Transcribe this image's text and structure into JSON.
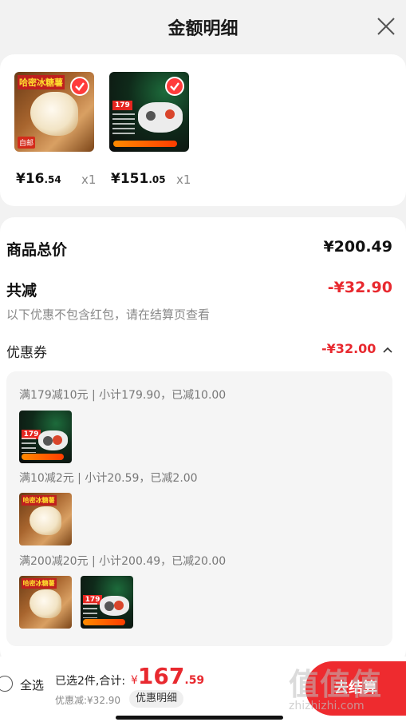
{
  "header": {
    "title": "金额明细"
  },
  "products": [
    {
      "price_int": "¥16",
      "price_dec": ".54",
      "qty": "x1",
      "art_tag": "哈密冰糖薯",
      "art_corner": "自邮",
      "checked": true
    },
    {
      "price_int": "¥151",
      "price_dec": ".05",
      "qty": "x1",
      "art_price": "179",
      "checked": true
    }
  ],
  "summary": {
    "total_label": "商品总价",
    "total_value": "¥200.49",
    "reduce_label": "共减",
    "reduce_value": "-¥32.90",
    "note": "以下优惠不包含红包，请在结算页查看",
    "coupon_label": "优惠券",
    "coupon_value": "-¥32.00",
    "coupon_toggle_icon": "chevron-up-icon"
  },
  "coupon_rules": [
    {
      "text": "满179减10元 | 小计179.90，已减10.00",
      "items": [
        "gamepad"
      ]
    },
    {
      "text": "满10减2元 | 小计20.59，已减2.00",
      "items": [
        "potato"
      ]
    },
    {
      "text": "满200减20元 | 小计200.49，已减20.00",
      "items": [
        "potato",
        "gamepad"
      ]
    }
  ],
  "footer": {
    "select_all": "全选",
    "selected_summary": "已选2件,合计:",
    "amount_currency": "¥",
    "amount_int": "167",
    "amount_dec": ".59",
    "discount_text": "优惠减:¥32.90",
    "detail_button": "优惠明细",
    "checkout_button": "去结算"
  },
  "watermark": {
    "text": "值值值",
    "sub": "zhizhizhi.com"
  },
  "colors": {
    "accent_red": "#e8292f",
    "checkout_red": "#ee2b2f"
  }
}
